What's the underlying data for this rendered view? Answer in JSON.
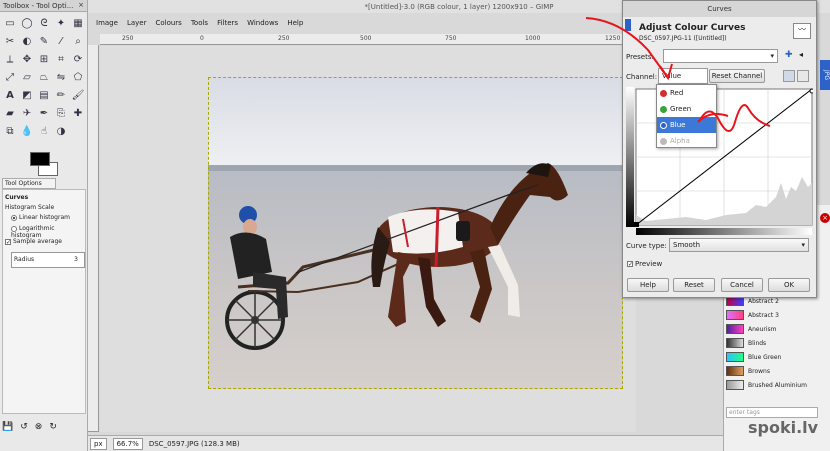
{
  "toolbox": {
    "title": "Toolbox - Tool Opti...",
    "close": "×",
    "tool_options_tab": "Tool Options",
    "panel_title": "Curves",
    "histogram_scale_label": "Histogram Scale",
    "linear_label": "Linear histogram",
    "log_label": "Logarithmic histogram",
    "sample_average_label": "Sample average",
    "radius_label": "Radius",
    "radius_value": "3"
  },
  "main": {
    "title": "*[Untitled]-3.0 (RGB colour, 1 layer) 1200x910 – GIMP",
    "menu": [
      "Image",
      "Layer",
      "Colours",
      "Tools",
      "Filters",
      "Windows",
      "Help"
    ],
    "ruler_ticks": [
      "250",
      "0",
      "250",
      "500",
      "750",
      "1000",
      "1250"
    ],
    "status": {
      "unit": "px",
      "zoom": "66.7%",
      "file": "DSC_0597.JPG (128.3 MB)"
    }
  },
  "curves": {
    "window_title": "Curves",
    "heading": "Adjust Colour Curves",
    "subheading": "DSC_0597.JPG-11 ([Untitled])",
    "presets_label": "Presets:",
    "channel_label": "Channel:",
    "channel_value": "Value",
    "reset_channel": "Reset Channel",
    "channel_options": [
      {
        "label": "Red",
        "color": "#d23030"
      },
      {
        "label": "Green",
        "color": "#3aa33a"
      },
      {
        "label": "Blue",
        "color": "#2d62c8"
      },
      {
        "label": "Alpha",
        "color": "#aaaaaa"
      }
    ],
    "curve_type_label": "Curve type:",
    "curve_type_value": "Smooth",
    "preview_label": "Preview",
    "buttons": {
      "help": "Help",
      "reset": "Reset",
      "cancel": "Cancel",
      "ok": "OK"
    }
  },
  "gradients": [
    "Abstract 2",
    "Abstract 3",
    "Aneurism",
    "Blinds",
    "Blue Green",
    "Browns",
    "Brushed Aluminium"
  ],
  "gradient_colors": [
    [
      "#c00040",
      "#4040ff"
    ],
    [
      "#e070ff",
      "#ff4080"
    ],
    [
      "#5020a0",
      "#ff40c0"
    ],
    [
      "#333",
      "#ddd"
    ],
    [
      "#30c0ff",
      "#20ff80"
    ],
    [
      "#603010",
      "#e0a060"
    ],
    [
      "#999",
      "#eee"
    ]
  ],
  "filter_placeholder": "enter tags",
  "image_side_label": "JPG",
  "watermark": "spoki.lv"
}
